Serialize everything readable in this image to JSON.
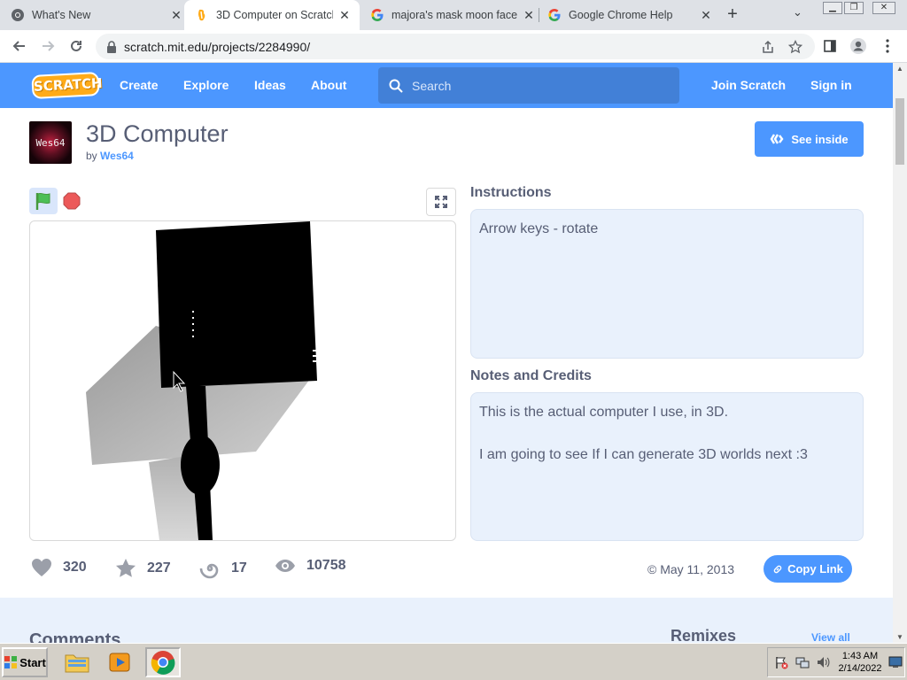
{
  "browser": {
    "tabs": [
      {
        "title": "What's New",
        "icon": "chrome-icon"
      },
      {
        "title": "3D Computer on Scratch",
        "icon": "scratch-icon",
        "active": true
      },
      {
        "title": "majora's mask moon face",
        "icon": "google-icon"
      },
      {
        "title": "Google Chrome Help",
        "icon": "google-icon"
      }
    ],
    "url": "scratch.mit.edu/projects/2284990/"
  },
  "scratch_nav": {
    "logo": "SCRATCH",
    "links": [
      "Create",
      "Explore",
      "Ideas",
      "About"
    ],
    "search_placeholder": "Search",
    "join": "Join Scratch",
    "signin": "Sign in"
  },
  "project": {
    "title": "3D Computer",
    "by_prefix": "by",
    "author": "Wes64",
    "avatar_text": "Wes64",
    "see_inside": "See inside",
    "instructions_title": "Instructions",
    "instructions": "Arrow keys - rotate",
    "notes_title": "Notes and Credits",
    "notes_line1": "This is the actual computer I use, in 3D.",
    "notes_line2": "I am going to see If I can generate 3D worlds next :3",
    "stats": {
      "loves": "320",
      "favorites": "227",
      "remixes": "17",
      "views": "10758"
    },
    "date": "May 11, 2013",
    "copy_link": "Copy Link"
  },
  "lower": {
    "comments": "Comments",
    "remixes": "Remixes",
    "view_all": "View all"
  },
  "taskbar": {
    "start": "Start",
    "time": "1:43 AM",
    "date": "2/14/2022"
  },
  "colors": {
    "scratch_blue": "#4c97ff",
    "scratch_orange": "#ffab19",
    "text": "#575e75"
  }
}
